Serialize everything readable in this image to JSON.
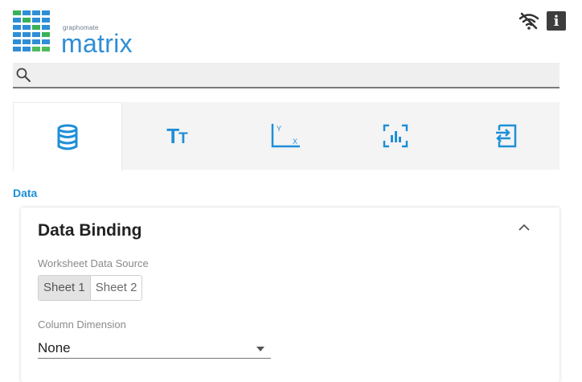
{
  "logo": {
    "small_text": "graphomate",
    "big_text": "matrix"
  },
  "header": {
    "info_label": "i",
    "icons": [
      "wifi-off-icon",
      "info-icon"
    ]
  },
  "search": {
    "value": "",
    "placeholder": ""
  },
  "tabs": [
    {
      "name": "data",
      "icon": "database-icon",
      "active": true
    },
    {
      "name": "text",
      "icon": "text-size-icon",
      "label": "TT",
      "active": false
    },
    {
      "name": "axes",
      "icon": "axis-icon",
      "active": false
    },
    {
      "name": "chart",
      "icon": "bar-chart-icon",
      "active": false
    },
    {
      "name": "export",
      "icon": "import-export-icon",
      "active": false
    }
  ],
  "colors": {
    "accent": "#1e8fd8",
    "logo_blue": "#2e8ed6",
    "logo_green": "#3bb54a"
  },
  "section": {
    "title": "Data"
  },
  "panel": {
    "title": "Data Binding",
    "source_label": "Worksheet Data Source",
    "sheets": [
      "Sheet 1",
      "Sheet 2"
    ],
    "selected_sheet": "Sheet 1",
    "dimension_label": "Column Dimension",
    "dimension_value": "None"
  }
}
